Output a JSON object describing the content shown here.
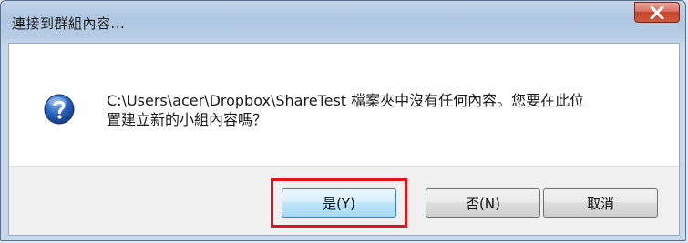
{
  "window": {
    "title": "連接到群組內容...",
    "close_symbol": "X"
  },
  "dialog": {
    "icon": "question-icon",
    "message_line1": "C:\\Users\\acer\\Dropbox\\ShareTest 檔案夾中沒有任何內容。您要在此位",
    "message_line2": "置建立新的小組內容嗎？"
  },
  "buttons": {
    "yes_label": "是(Y)",
    "no_label": "否(N)",
    "cancel_label": "取消"
  },
  "colors": {
    "highlight": "#e0141e",
    "close_button": "#c5432b"
  }
}
